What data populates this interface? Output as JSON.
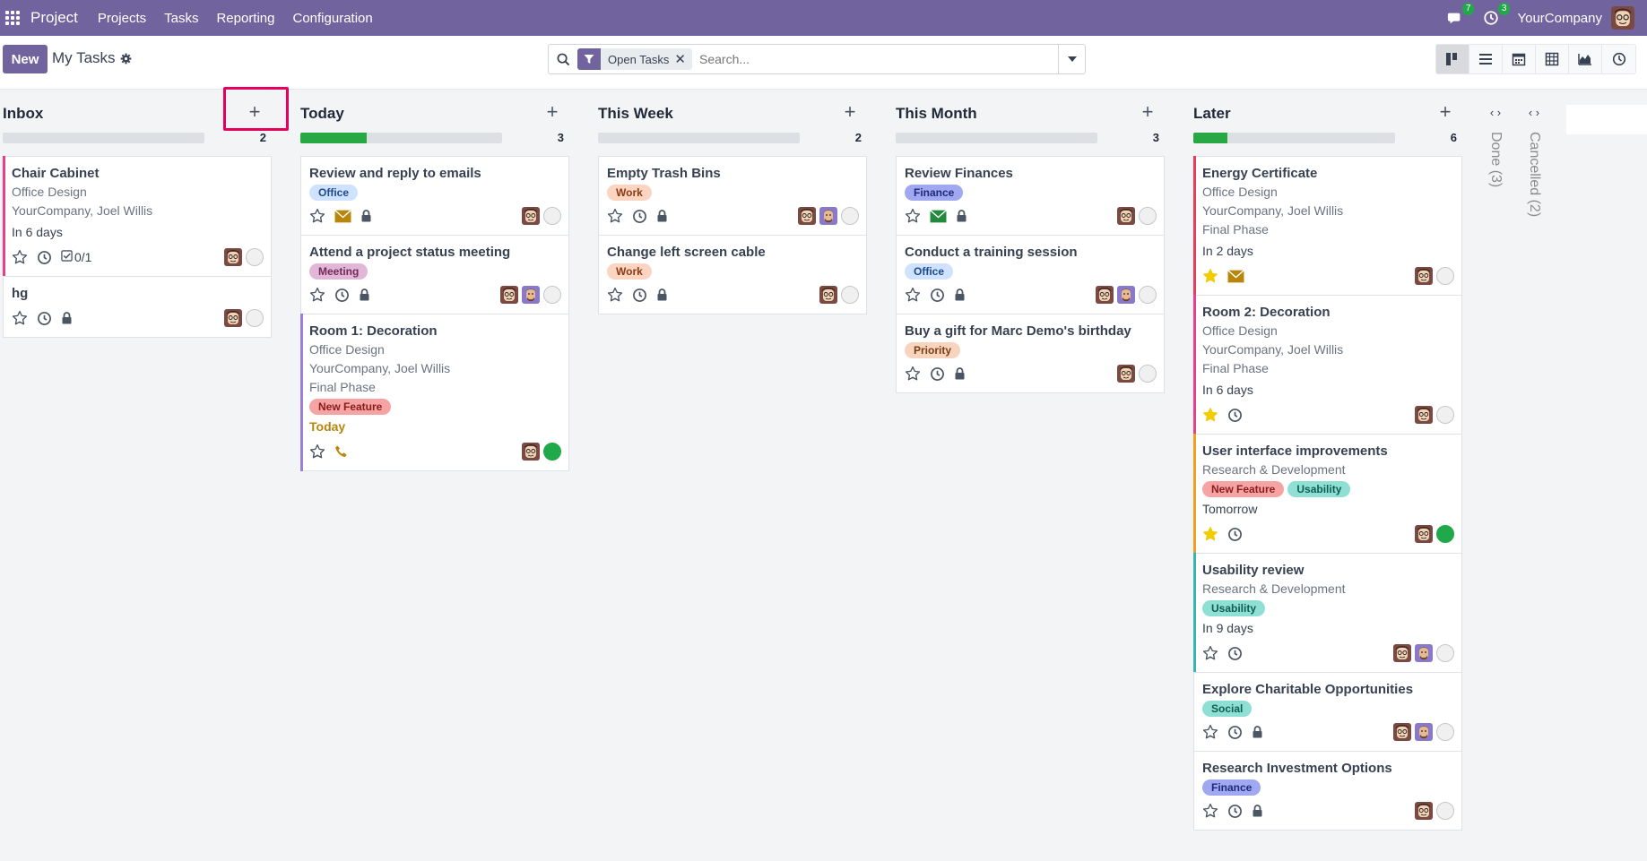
{
  "navbar": {
    "brand": "Project",
    "menu": [
      "Projects",
      "Tasks",
      "Reporting",
      "Configuration"
    ],
    "messages_count": "7",
    "activities_count": "3",
    "company": "YourCompany"
  },
  "control": {
    "new_label": "New",
    "breadcrumb": "My Tasks",
    "facet_label": "Open Tasks",
    "search_placeholder": "Search...",
    "views": [
      "kanban-icon",
      "list-icon",
      "calendar-icon",
      "pivot-icon",
      "graph-icon",
      "activity-icon"
    ]
  },
  "columns": [
    {
      "title": "Inbox",
      "count": "2",
      "progress": 0,
      "cards": [
        {
          "title": "Chair Cabinet",
          "lines": [
            "Office Design",
            "YourCompany, Joel Willis"
          ],
          "date": "In 6 days",
          "stripe": "#e83e8c",
          "tags": [],
          "icons": [
            "star",
            "clock",
            "checklist"
          ],
          "checklist": "0/1",
          "avatars": 1,
          "state": "grey"
        },
        {
          "title": "hg",
          "lines": [],
          "date": "",
          "stripe": "",
          "tags": [],
          "icons": [
            "star",
            "clock",
            "lock"
          ],
          "avatars": 1,
          "state": "grey"
        }
      ]
    },
    {
      "title": "Today",
      "count": "3",
      "progress": 0.33,
      "cards": [
        {
          "title": "Review and reply to emails",
          "lines": [],
          "date": "",
          "stripe": "",
          "tags": [
            {
              "label": "Office",
              "bg": "#cfe2ff",
              "fg": "#1e4a8c"
            }
          ],
          "icons": [
            "star",
            "envelope-orange",
            "lock"
          ],
          "avatars": 1,
          "state": "grey"
        },
        {
          "title": "Attend a project status meeting",
          "lines": [],
          "date": "",
          "stripe": "",
          "tags": [
            {
              "label": "Meeting",
              "bg": "#e2b6d6",
              "fg": "#6f2a5c"
            }
          ],
          "icons": [
            "star",
            "clock",
            "lock"
          ],
          "avatars": 2,
          "state": "grey"
        },
        {
          "title": "Room 1: Decoration",
          "lines": [
            "Office Design",
            "YourCompany, Joel Willis",
            "Final Phase"
          ],
          "date": "Today",
          "today": true,
          "stripe": "#9b7fd4",
          "tags": [
            {
              "label": "New Feature",
              "bg": "#f5a3a3",
              "fg": "#8a1c1c"
            }
          ],
          "icons": [
            "star",
            "phone"
          ],
          "avatars": 1,
          "state": "green"
        }
      ]
    },
    {
      "title": "This Week",
      "count": "2",
      "progress": 0,
      "cards": [
        {
          "title": "Empty Trash Bins",
          "lines": [],
          "date": "",
          "stripe": "",
          "tags": [
            {
              "label": "Work",
              "bg": "#fbd5c2",
              "fg": "#8a3b12"
            }
          ],
          "icons": [
            "star",
            "clock",
            "lock"
          ],
          "avatars": 2,
          "state": "grey"
        },
        {
          "title": "Change left screen cable",
          "lines": [],
          "date": "",
          "stripe": "",
          "tags": [
            {
              "label": "Work",
              "bg": "#fbd5c2",
              "fg": "#8a3b12"
            }
          ],
          "icons": [
            "star",
            "clock",
            "lock"
          ],
          "avatars": 1,
          "state": "grey"
        }
      ]
    },
    {
      "title": "This Month",
      "count": "3",
      "progress": 0,
      "cards": [
        {
          "title": "Review Finances",
          "lines": [],
          "date": "",
          "stripe": "",
          "tags": [
            {
              "label": "Finance",
              "bg": "#9fa8f0",
              "fg": "#1f2a7a"
            }
          ],
          "icons": [
            "star",
            "envelope-green",
            "lock"
          ],
          "avatars": 1,
          "state": "grey"
        },
        {
          "title": "Conduct a training session",
          "lines": [],
          "date": "",
          "stripe": "",
          "tags": [
            {
              "label": "Office",
              "bg": "#cfe2ff",
              "fg": "#1e4a8c"
            }
          ],
          "icons": [
            "star",
            "clock",
            "lock"
          ],
          "avatars": 2,
          "state": "grey"
        },
        {
          "title": "Buy a gift for Marc Demo's birthday",
          "lines": [],
          "date": "",
          "stripe": "",
          "tags": [
            {
              "label": "Priority",
              "bg": "#f7d4bd",
              "fg": "#7a3b12"
            }
          ],
          "icons": [
            "star",
            "clock",
            "lock"
          ],
          "avatars": 1,
          "state": "grey"
        }
      ]
    },
    {
      "title": "Later",
      "count": "6",
      "progress": 0.17,
      "cards": [
        {
          "title": "Energy Certificate",
          "lines": [
            "Office Design",
            "YourCompany, Joel Willis",
            "Final Phase"
          ],
          "date": "In 2 days",
          "stripe": "#e83e5c",
          "tags": [],
          "icons": [
            "star-filled",
            "envelope-orange"
          ],
          "avatars": 1,
          "state": "grey"
        },
        {
          "title": "Room 2: Decoration",
          "lines": [
            "Office Design",
            "YourCompany, Joel Willis",
            "Final Phase"
          ],
          "date": "In 6 days",
          "stripe": "#e83e8c",
          "tags": [],
          "icons": [
            "star-filled",
            "clock"
          ],
          "avatars": 1,
          "state": "grey"
        },
        {
          "title": "User interface improvements",
          "lines": [
            "Research & Development"
          ],
          "date": "Tomorrow",
          "stripe": "#f0a020",
          "tags": [
            {
              "label": "New Feature",
              "bg": "#f5a3a3",
              "fg": "#8a1c1c"
            },
            {
              "label": "Usability",
              "bg": "#8fe0d4",
              "fg": "#0f5c52"
            }
          ],
          "icons": [
            "star-filled",
            "clock"
          ],
          "avatars": 1,
          "state": "green"
        },
        {
          "title": "Usability review",
          "lines": [
            "Research & Development"
          ],
          "date": "In 9 days",
          "stripe": "#3cb3b0",
          "tags": [
            {
              "label": "Usability",
              "bg": "#8fe0d4",
              "fg": "#0f5c52"
            }
          ],
          "icons": [
            "star",
            "clock"
          ],
          "avatars": 2,
          "state": "grey"
        },
        {
          "title": "Explore Charitable Opportunities",
          "lines": [],
          "date": "",
          "stripe": "",
          "tags": [
            {
              "label": "Social",
              "bg": "#8fe0d4",
              "fg": "#0f5c52"
            }
          ],
          "icons": [
            "star",
            "clock",
            "lock"
          ],
          "avatars": 2,
          "state": "grey"
        },
        {
          "title": "Research Investment Options",
          "lines": [],
          "date": "",
          "stripe": "",
          "tags": [
            {
              "label": "Finance",
              "bg": "#9fa8f0",
              "fg": "#1f2a7a"
            }
          ],
          "icons": [
            "star",
            "clock",
            "lock"
          ],
          "avatars": 1,
          "state": "grey"
        }
      ]
    }
  ],
  "folded": [
    {
      "label": "Done (3)"
    },
    {
      "label": "Cancelled (2)"
    }
  ]
}
